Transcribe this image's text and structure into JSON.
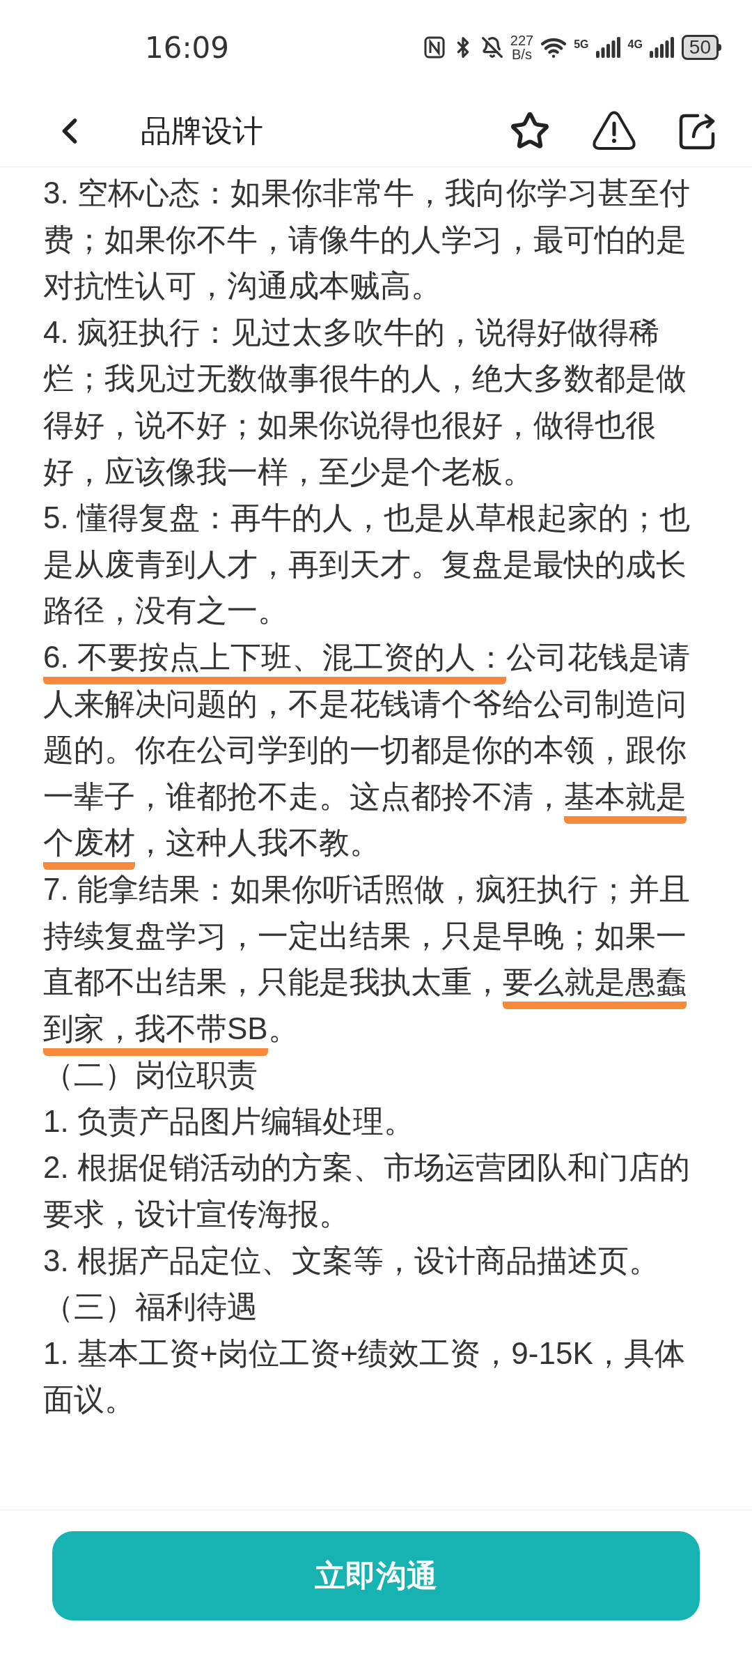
{
  "status_bar": {
    "time": "16:09",
    "net_speed_value": "227",
    "net_speed_unit": "B/s",
    "network_5g": "5G",
    "network_4g": "4G",
    "battery": "50"
  },
  "header": {
    "title": "品牌设计"
  },
  "paragraphs": [
    {
      "segments": [
        {
          "text": "3. 空杯心态：如果你非常牛，我向你学习甚至付费；如果你不牛，请像牛的人学习，最可怕的是对抗性认可，沟通成本贼高。",
          "underlined": false
        }
      ]
    },
    {
      "segments": [
        {
          "text": "4. 疯狂执行：见过太多吹牛的，说得好做得稀烂；我见过无数做事很牛的人，绝大多数都是做得好，说不好；如果你说得也很好，做得也很好，应该像我一样，至少是个老板。",
          "underlined": false
        }
      ]
    },
    {
      "segments": [
        {
          "text": "5. 懂得复盘：再牛的人，也是从草根起家的；也是从废青到人才，再到天才。复盘是最快的成长路径，没有之一。",
          "underlined": false
        }
      ]
    },
    {
      "segments": [
        {
          "text": "6. 不要按点上下班、混工资的人：",
          "underlined": true
        },
        {
          "text": "公司花钱是请人来解决问题的，不是花钱请个爷给公司制造问题的。你在公司学到的一切都是你的本领，跟你一辈子，谁都抢不走。这点都拎不清，",
          "underlined": false
        },
        {
          "text": "基本就是个废材",
          "underlined": true
        },
        {
          "text": "，这种人我不教。",
          "underlined": false
        }
      ]
    },
    {
      "segments": [
        {
          "text": "7. 能拿结果：如果你听话照做，疯狂执行；并且持续复盘学习，一定出结果，只是早晚；如果一直都不出结果，只能是我执太重，",
          "underlined": false
        },
        {
          "text": "要么就是愚蠢到家，我不带SB",
          "underlined": true
        },
        {
          "text": "。",
          "underlined": false
        }
      ]
    },
    {
      "segments": [
        {
          "text": "（二）岗位职责",
          "underlined": false
        }
      ]
    },
    {
      "segments": [
        {
          "text": "1. 负责产品图片编辑处理。",
          "underlined": false
        }
      ]
    },
    {
      "segments": [
        {
          "text": "2. 根据促销活动的方案、市场运营团队和门店的要求，设计宣传海报。",
          "underlined": false
        }
      ]
    },
    {
      "segments": [
        {
          "text": "3. 根据产品定位、文案等，设计商品描述页。",
          "underlined": false
        }
      ]
    },
    {
      "segments": [
        {
          "text": "（三）福利待遇",
          "underlined": false
        }
      ]
    },
    {
      "segments": [
        {
          "text": "1. 基本工资+岗位工资+绩效工资，9-15K，具体面议。",
          "underlined": false
        }
      ]
    }
  ],
  "action_button": {
    "label": "立即沟通"
  }
}
